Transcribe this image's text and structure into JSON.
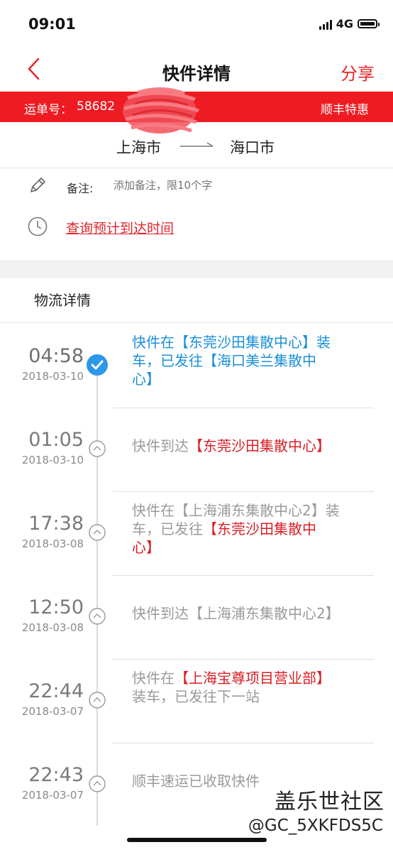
{
  "status_bar": {
    "time": "09:01",
    "network": "4G"
  },
  "nav": {
    "title": "快件详情",
    "share_label": "分享"
  },
  "banner": {
    "label": "运单号：",
    "number": "58682",
    "service": "顺丰特惠"
  },
  "route": {
    "from": "上海市",
    "to": "海口市"
  },
  "note": {
    "label": "备注:",
    "placeholder": "添加备注，限10个字"
  },
  "eta_link": "查询预计到达时间",
  "section_title": "物流详情",
  "entries": [
    {
      "time": "04:58",
      "date": "2018-03-10",
      "lines": [
        "快件在【东莞沙田集散中心】装",
        "车，已发往【海口美兰集散中",
        "心】"
      ]
    },
    {
      "time": "01:05",
      "date": "2018-03-10",
      "prefix": "快件到达",
      "highlight": "【东莞沙田集散中心】"
    },
    {
      "time": "17:38",
      "date": "2018-03-08",
      "line1": "快件在【上海浦东集散中心2】装",
      "line2_prefix": "车，已发往",
      "line2_hl": "【东莞沙田集散中",
      "line3_hl": "心】"
    },
    {
      "time": "12:50",
      "date": "2018-03-08",
      "text": "快件到达【上海浦东集散中心2】"
    },
    {
      "time": "22:44",
      "date": "2018-03-07",
      "prefix": "快件在",
      "highlight": "【上海宝尊项目营业部】",
      "line2": "装车，已发往下一站"
    },
    {
      "time": "22:43",
      "date": "2018-03-07",
      "text": "顺丰速运已收取快件"
    }
  ],
  "watermark": {
    "site": "盖乐世社区",
    "user": "@GC_5XKFDS5C"
  },
  "colors": {
    "brand_red": "#ef1b22",
    "latest_blue": "#1a8fd8",
    "highlight_red": "#d81e24"
  }
}
